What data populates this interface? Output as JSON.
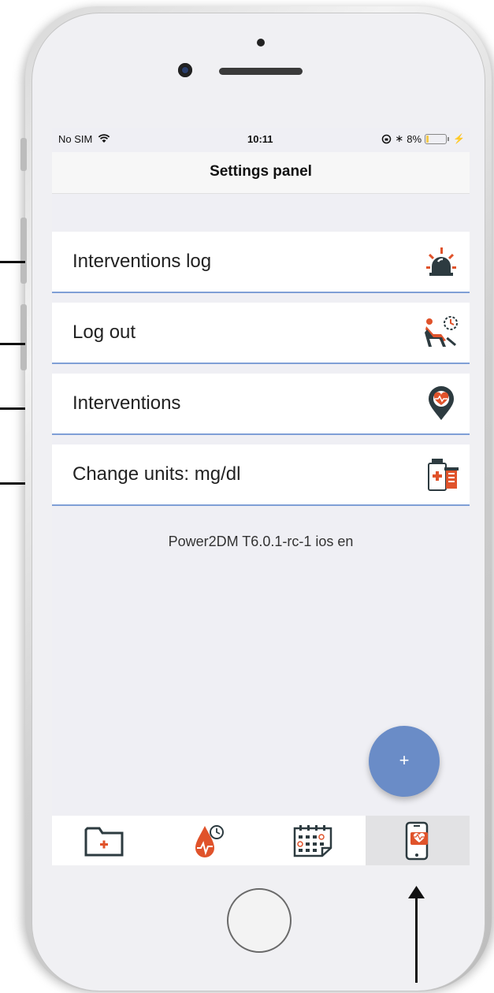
{
  "status_bar": {
    "carrier": "No SIM",
    "time": "10:11",
    "battery": "8%"
  },
  "header": {
    "title": "Settings panel"
  },
  "settings": {
    "items": [
      {
        "label": "Interventions log",
        "icon": "siren-icon"
      },
      {
        "label": "Log out",
        "icon": "person-relax-icon"
      },
      {
        "label": "Interventions",
        "icon": "heart-pin-icon"
      },
      {
        "label": "Change units: mg/dl",
        "icon": "medicine-icon"
      }
    ]
  },
  "version": "Power2DM T6.0.1-rc-1 ios en",
  "fab": {
    "label": "+"
  },
  "tab_bar": {
    "tabs": [
      {
        "icon": "medical-folder-icon",
        "active": false
      },
      {
        "icon": "blood-drop-icon",
        "active": false
      },
      {
        "icon": "calendar-icon",
        "active": false
      },
      {
        "icon": "phone-heart-icon",
        "active": true
      }
    ]
  },
  "colors": {
    "accent_orange": "#e0532b",
    "dark_teal": "#2d3b40",
    "row_border": "#7f9fd6",
    "fab_blue": "#6a8cc7",
    "background": "#efeff4"
  }
}
